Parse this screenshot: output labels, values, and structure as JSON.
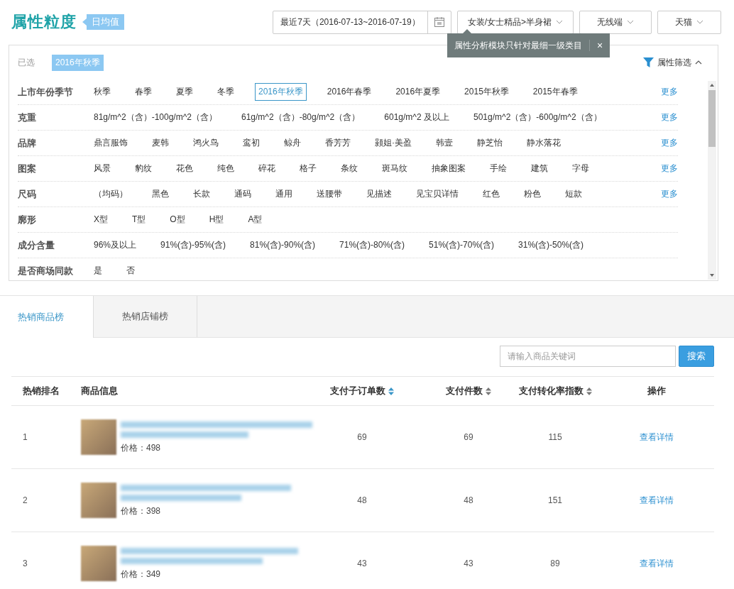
{
  "header": {
    "title": "属性粒度",
    "badge": "日均值",
    "date_range": "最近7天（2016-07-13~2016-07-19）",
    "filters": [
      {
        "label": "女装/女士精品>半身裙"
      },
      {
        "label": "无线端"
      },
      {
        "label": "天猫"
      }
    ],
    "tooltip": {
      "text": "属性分析模块只针对最细一级类目",
      "close": "×"
    }
  },
  "attribute_panel": {
    "selected_label": "已选",
    "selected_chips": [
      "2016年秋季"
    ],
    "filter_toggle": "属性筛选",
    "expanded": true,
    "rows": [
      {
        "label": "上市年份季节",
        "more": "更多",
        "options": [
          {
            "label": "秋季",
            "selected": false
          },
          {
            "label": "春季",
            "selected": false
          },
          {
            "label": "夏季",
            "selected": false
          },
          {
            "label": "冬季",
            "selected": false
          },
          {
            "label": "2016年秋季",
            "selected": true
          },
          {
            "label": "2016年春季",
            "selected": false
          },
          {
            "label": "2016年夏季",
            "selected": false
          },
          {
            "label": "2015年秋季",
            "selected": false
          },
          {
            "label": "2015年春季",
            "selected": false
          }
        ]
      },
      {
        "label": "克重",
        "more": "更多",
        "options": [
          {
            "label": "81g/m^2（含）-100g/m^2（含）",
            "selected": false
          },
          {
            "label": "61g/m^2（含）-80g/m^2（含）",
            "selected": false
          },
          {
            "label": "601g/m^2 及以上",
            "selected": false
          },
          {
            "label": "501g/m^2（含）-600g/m^2（含）",
            "selected": false
          }
        ]
      },
      {
        "label": "品牌",
        "more": "更多",
        "options": [
          {
            "label": "鼎言服饰",
            "selected": false
          },
          {
            "label": "麦韩",
            "selected": false
          },
          {
            "label": "鸿火鸟",
            "selected": false
          },
          {
            "label": "鸾初",
            "selected": false
          },
          {
            "label": "鲸舟",
            "selected": false
          },
          {
            "label": "香芳芳",
            "selected": false
          },
          {
            "label": "颢姐·美盈",
            "selected": false
          },
          {
            "label": "韩壹",
            "selected": false
          },
          {
            "label": "静芝怡",
            "selected": false
          },
          {
            "label": "静水落花",
            "selected": false
          }
        ]
      },
      {
        "label": "图案",
        "more": "更多",
        "options": [
          {
            "label": "风景",
            "selected": false
          },
          {
            "label": "豹纹",
            "selected": false
          },
          {
            "label": "花色",
            "selected": false
          },
          {
            "label": "纯色",
            "selected": false
          },
          {
            "label": "碎花",
            "selected": false
          },
          {
            "label": "格子",
            "selected": false
          },
          {
            "label": "条纹",
            "selected": false
          },
          {
            "label": "斑马纹",
            "selected": false
          },
          {
            "label": "抽象图案",
            "selected": false
          },
          {
            "label": "手绘",
            "selected": false
          },
          {
            "label": "建筑",
            "selected": false
          },
          {
            "label": "字母",
            "selected": false
          }
        ]
      },
      {
        "label": "尺码",
        "more": "更多",
        "options": [
          {
            "label": "（均码）",
            "selected": false
          },
          {
            "label": "黑色",
            "selected": false
          },
          {
            "label": "长款",
            "selected": false
          },
          {
            "label": "通码",
            "selected": false
          },
          {
            "label": "通用",
            "selected": false
          },
          {
            "label": "送腰带",
            "selected": false
          },
          {
            "label": "见描述",
            "selected": false
          },
          {
            "label": "见宝贝详情",
            "selected": false
          },
          {
            "label": "红色",
            "selected": false
          },
          {
            "label": "粉色",
            "selected": false
          },
          {
            "label": "短款",
            "selected": false
          }
        ]
      },
      {
        "label": "廓形",
        "options": [
          {
            "label": "X型",
            "selected": false
          },
          {
            "label": "T型",
            "selected": false
          },
          {
            "label": "O型",
            "selected": false
          },
          {
            "label": "H型",
            "selected": false
          },
          {
            "label": "A型",
            "selected": false
          }
        ]
      },
      {
        "label": "成分含量",
        "options": [
          {
            "label": "96%及以上",
            "selected": false
          },
          {
            "label": "91%(含)-95%(含)",
            "selected": false
          },
          {
            "label": "81%(含)-90%(含)",
            "selected": false
          },
          {
            "label": "71%(含)-80%(含)",
            "selected": false
          },
          {
            "label": "51%(含)-70%(含)",
            "selected": false
          },
          {
            "label": "31%(含)-50%(含)",
            "selected": false
          }
        ]
      },
      {
        "label": "是否商场同款",
        "options": [
          {
            "label": "是",
            "selected": false
          },
          {
            "label": "否",
            "selected": false
          }
        ]
      }
    ]
  },
  "tabs": [
    {
      "label": "热销商品榜",
      "selected": true
    },
    {
      "label": "热销店铺榜",
      "selected": false
    }
  ],
  "search": {
    "placeholder": "请输入商品关键词",
    "button": "搜索"
  },
  "table": {
    "columns": [
      {
        "label": "热销排名",
        "kind": "plain"
      },
      {
        "label": "商品信息",
        "kind": "plain"
      },
      {
        "label": "支付子订单数",
        "kind": "sortable",
        "sorted": true
      },
      {
        "label": "支付件数",
        "kind": "sortable",
        "sorted": false
      },
      {
        "label": "支付转化率指数",
        "kind": "sortable",
        "sorted": false
      },
      {
        "label": "操作",
        "kind": "plain"
      }
    ],
    "rows": [
      {
        "rank": "1",
        "price": "价格：498",
        "orders": "69",
        "items": "69",
        "conversion": "115",
        "action": "查看详情"
      },
      {
        "rank": "2",
        "price": "价格：398",
        "orders": "48",
        "items": "48",
        "conversion": "151",
        "action": "查看详情"
      },
      {
        "rank": "3",
        "price": "价格：349",
        "orders": "43",
        "items": "43",
        "conversion": "89",
        "action": "查看详情"
      }
    ]
  }
}
